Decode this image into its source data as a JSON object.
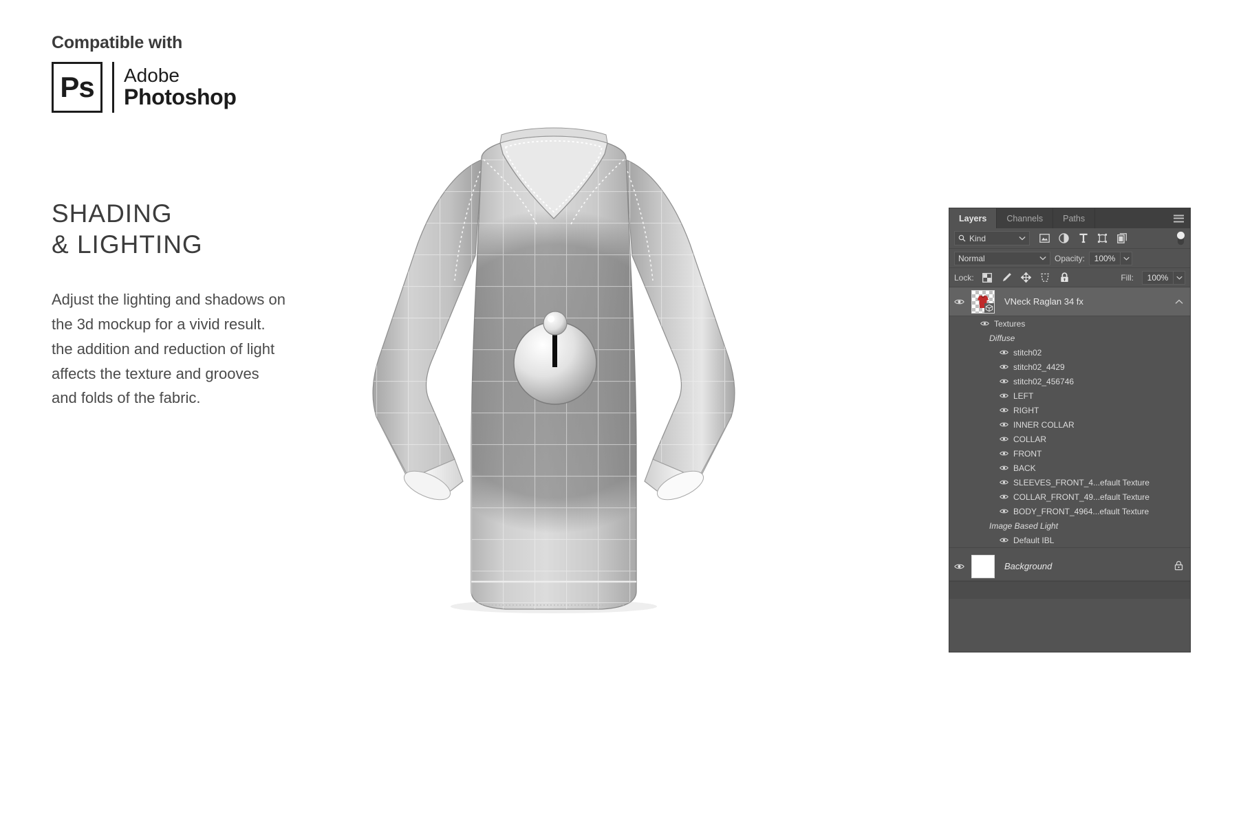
{
  "left_column": {
    "compatible_label": "Compatible with",
    "brand": {
      "badge_text": "Ps",
      "line1": "Adobe",
      "line2": "Photoshop"
    },
    "headline": "SHADING\n& LIGHTING",
    "body": "Adjust the lighting and shadows on\nthe 3d mockup for a vivid result.\nthe addition and reduction of light\naffects the texture and grooves\nand folds of the fabric."
  },
  "mockup": {
    "name": "vneck-raglan-3d-shirt-mockup",
    "light_widget": "point-light-gizmo"
  },
  "layers_panel": {
    "tabs": [
      {
        "label": "Layers",
        "active": true
      },
      {
        "label": "Channels",
        "active": false
      },
      {
        "label": "Paths",
        "active": false
      }
    ],
    "menu_icon": "panel-menu-icon",
    "filter": {
      "kind_label": "Kind",
      "search_icon": "search-icon",
      "icons": [
        "pixel-layer-filter-icon",
        "adjustment-layer-filter-icon",
        "type-layer-filter-icon",
        "shape-layer-filter-icon",
        "smart-object-filter-icon"
      ],
      "toggle": "filter-enable-toggle"
    },
    "blend": {
      "mode": "Normal",
      "opacity_label": "Opacity:",
      "opacity_value": "100%"
    },
    "lock": {
      "label": "Lock:",
      "icons": [
        "lock-transparent-pixels-icon",
        "lock-image-pixels-icon",
        "lock-position-icon",
        "lock-artboard-nesting-icon",
        "lock-all-icon"
      ],
      "fill_label": "Fill:",
      "fill_value": "100%"
    },
    "layers": [
      {
        "name": "VNeck Raglan 34 fx",
        "type": "3d-layer",
        "selected": true,
        "eye": true,
        "collapse_icon": "chevron-up-icon",
        "thumbnail": "red-tshirt-thumbnail",
        "badge": "3d-cube-badge"
      }
    ],
    "tree": [
      {
        "label": "Textures",
        "indent": 1,
        "eye": true,
        "italic": false
      },
      {
        "label": "Diffuse",
        "indent": 2,
        "eye": false,
        "italic": true
      },
      {
        "label": "stitch02",
        "indent": 3,
        "eye": true,
        "italic": false
      },
      {
        "label": "stitch02_4429",
        "indent": 3,
        "eye": true,
        "italic": false
      },
      {
        "label": "stitch02_456746",
        "indent": 3,
        "eye": true,
        "italic": false
      },
      {
        "label": "LEFT",
        "indent": 3,
        "eye": true,
        "italic": false
      },
      {
        "label": "RIGHT",
        "indent": 3,
        "eye": true,
        "italic": false
      },
      {
        "label": "INNER COLLAR",
        "indent": 3,
        "eye": true,
        "italic": false
      },
      {
        "label": "COLLAR",
        "indent": 3,
        "eye": true,
        "italic": false
      },
      {
        "label": "FRONT",
        "indent": 3,
        "eye": true,
        "italic": false
      },
      {
        "label": "BACK",
        "indent": 3,
        "eye": true,
        "italic": false
      },
      {
        "label": "SLEEVES_FRONT_4...efault Texture",
        "indent": 3,
        "eye": true,
        "italic": false
      },
      {
        "label": "COLLAR_FRONT_49...efault Texture",
        "indent": 3,
        "eye": true,
        "italic": false
      },
      {
        "label": "BODY_FRONT_4964...efault Texture",
        "indent": 3,
        "eye": true,
        "italic": false
      },
      {
        "label": "Image Based Light",
        "indent": 2,
        "eye": false,
        "italic": true
      },
      {
        "label": "Default IBL",
        "indent": 3,
        "eye": true,
        "italic": false
      }
    ],
    "background_layer": {
      "name": "Background",
      "eye": true,
      "locked": true,
      "lock_icon": "lock-icon",
      "thumbnail": "white-thumbnail"
    }
  },
  "colors": {
    "panel_bg": "#535353",
    "panel_tabbar": "#3f3f3f",
    "panel_selected_row": "#636363",
    "text_primary": "#e8e8e8",
    "page_text": "#3c3c3c",
    "ps_brand": "#1c1c1c"
  }
}
